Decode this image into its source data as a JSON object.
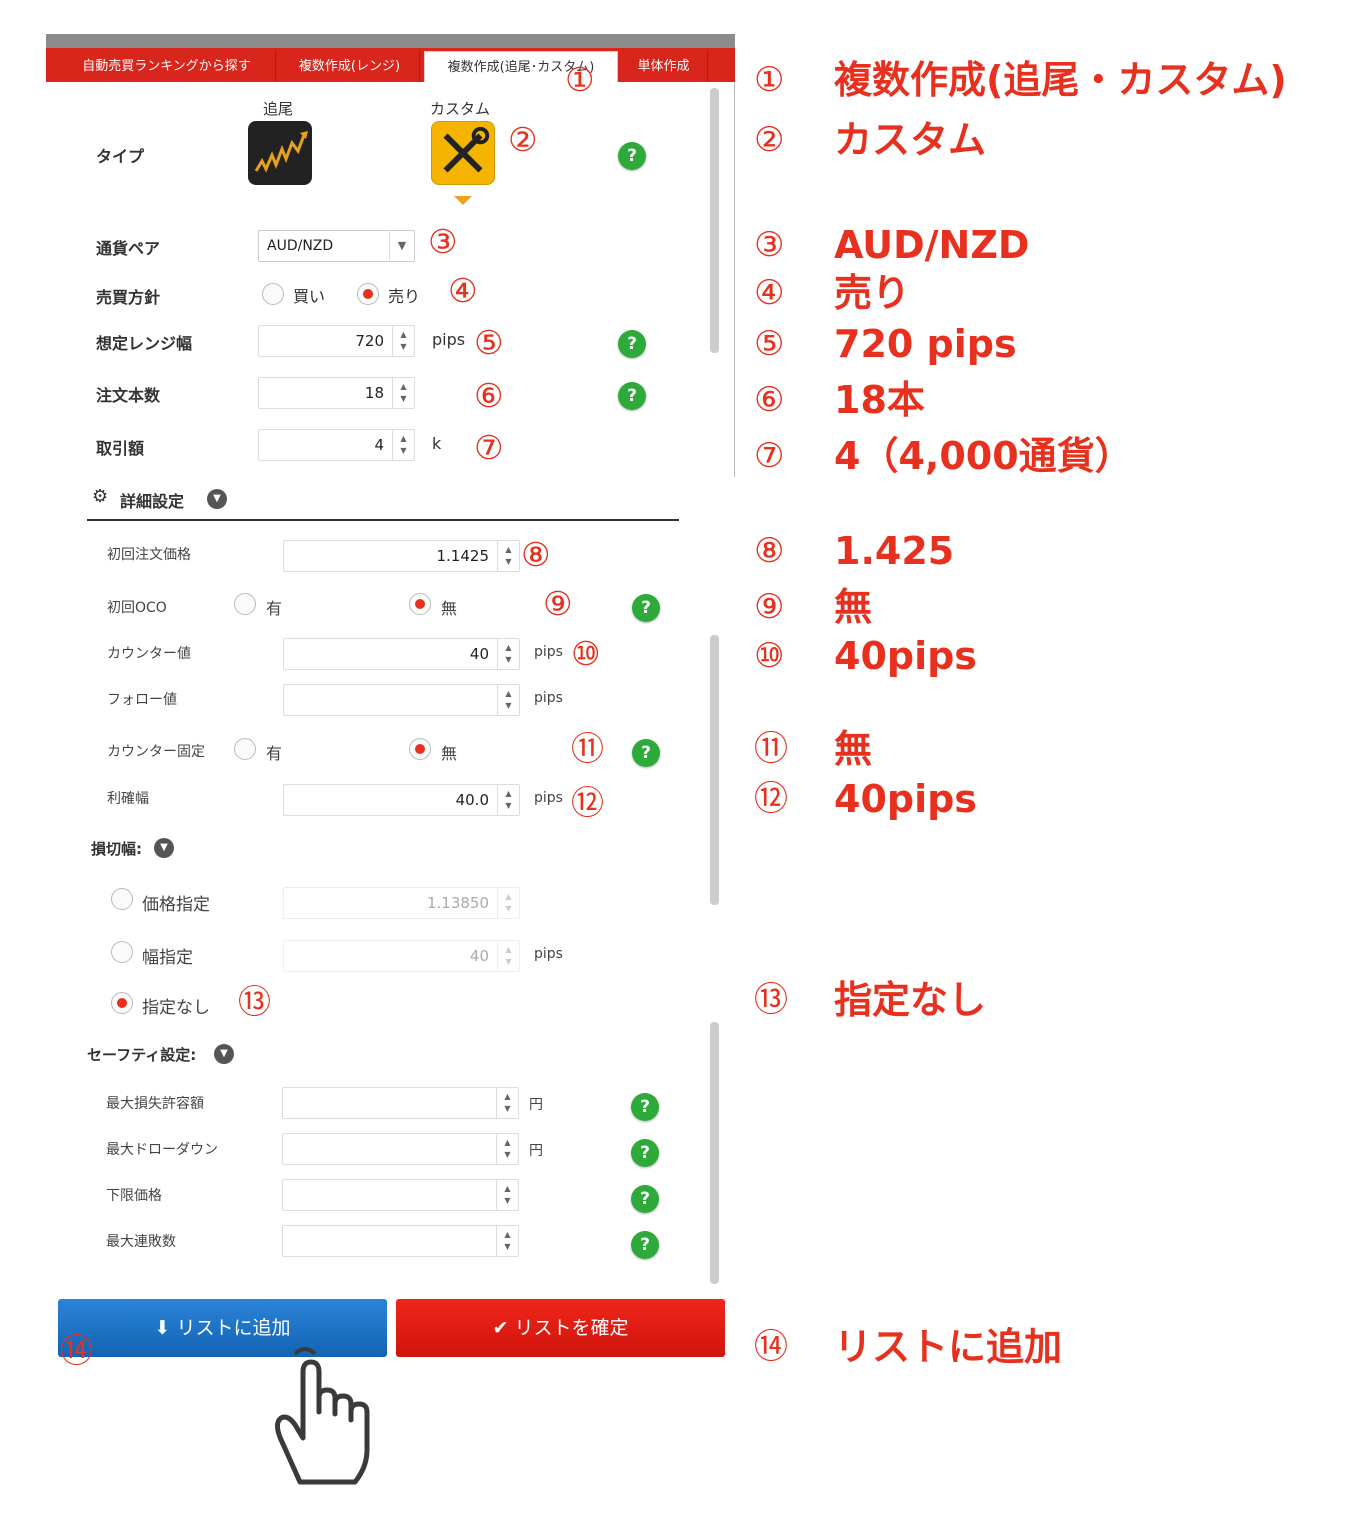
{
  "tabs": [
    {
      "label": "自動売買ランキングから探す"
    },
    {
      "label": "複数作成(レンジ)"
    },
    {
      "label": "複数作成(追尾･カスタム)"
    },
    {
      "label": "単体作成"
    }
  ],
  "type_row": {
    "label": "タイプ",
    "option1": {
      "label": "追尾",
      "icon": "trend-chart-icon"
    },
    "option2": {
      "label": "カスタム",
      "icon": "tools-icon"
    }
  },
  "currency": {
    "label": "通貨ペア",
    "value": "AUD/NZD"
  },
  "direction": {
    "label": "売買方針",
    "buy": "買い",
    "sell": "売り",
    "selected": "sell"
  },
  "range": {
    "label": "想定レンジ幅",
    "value": "720",
    "unit": "pips"
  },
  "orders": {
    "label": "注文本数",
    "value": "18"
  },
  "amount": {
    "label": "取引額",
    "value": "4",
    "unit": "k"
  },
  "detail": {
    "label": "詳細設定"
  },
  "first_price": {
    "label": "初回注文価格",
    "value": "1.1425"
  },
  "first_oco": {
    "label": "初回OCO",
    "yes": "有",
    "no": "無"
  },
  "counter": {
    "label": "カウンター値",
    "value": "40",
    "unit": "pips"
  },
  "follow": {
    "label": "フォロー値",
    "value": "",
    "unit": "pips"
  },
  "counter_fix": {
    "label": "カウンター固定",
    "yes": "有",
    "no": "無"
  },
  "profit": {
    "label": "利確幅",
    "value": "40.0",
    "unit": "pips"
  },
  "stoploss": {
    "label": "損切幅:",
    "price_opt": "価格指定",
    "price_value": "1.13850",
    "width_opt": "幅指定",
    "width_value": "40",
    "width_unit": "pips",
    "none_opt": "指定なし"
  },
  "safety": {
    "label": "セーフティ設定:",
    "max_loss": {
      "label": "最大損失許容額",
      "unit": "円"
    },
    "max_drawdown": {
      "label": "最大ドローダウン",
      "unit": "円"
    },
    "lower_price": {
      "label": "下限価格"
    },
    "max_losses": {
      "label": "最大連敗数"
    }
  },
  "buttons": {
    "add": "リストに追加",
    "confirm": "リストを確定"
  },
  "markers": [
    "①",
    "②",
    "③",
    "④",
    "⑤",
    "⑥",
    "⑦",
    "⑧",
    "⑨",
    "⑩",
    "⑪",
    "⑫",
    "⑬",
    "⑭"
  ],
  "annotations": [
    {
      "num": "①",
      "text": "複数作成(追尾・カスタム)"
    },
    {
      "num": "②",
      "text": "カスタム"
    },
    {
      "num": "③",
      "text": "AUD/NZD"
    },
    {
      "num": "④",
      "text": "売り"
    },
    {
      "num": "⑤",
      "text": "720 pips"
    },
    {
      "num": "⑥",
      "text": "18本"
    },
    {
      "num": "⑦",
      "text": "4（4,000通貨）"
    },
    {
      "num": "⑧",
      "text": "1.425"
    },
    {
      "num": "⑨",
      "text": "無"
    },
    {
      "num": "⑩",
      "text": "40pips"
    },
    {
      "num": "⑪",
      "text": "無"
    },
    {
      "num": "⑫",
      "text": "40pips"
    },
    {
      "num": "⑬",
      "text": "指定なし"
    },
    {
      "num": "⑭",
      "text": "リストに追加"
    }
  ],
  "colors": {
    "brand_red": "#d9261c",
    "annotation_red": "#e8301e",
    "help_green": "#2eaa3a",
    "add_blue": "#1a73c9"
  }
}
